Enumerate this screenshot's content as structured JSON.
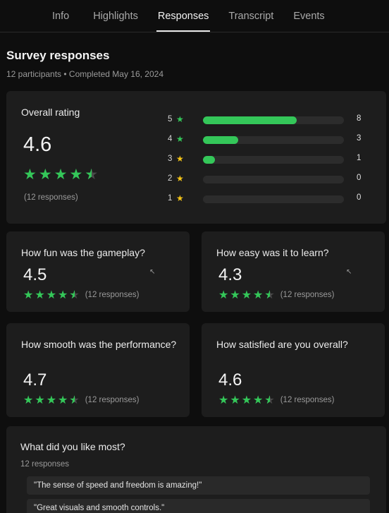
{
  "tabs": [
    {
      "label": "Info",
      "active": false
    },
    {
      "label": "Highlights",
      "active": false
    },
    {
      "label": "Responses",
      "active": true
    },
    {
      "label": "Transcript",
      "active": false
    },
    {
      "label": "Events",
      "active": false
    }
  ],
  "page": {
    "title": "Survey responses",
    "subtitle": "12 participants • Completed May 16, 2024"
  },
  "overall": {
    "label": "Overall rating",
    "value": "4.6",
    "rating": 4.6,
    "responses_label": "(12 responses)",
    "distribution": [
      {
        "stars": "5",
        "count": "8",
        "fraction": 0.667
      },
      {
        "stars": "4",
        "count": "3",
        "fraction": 0.25
      },
      {
        "stars": "3",
        "count": "1",
        "fraction": 0.083
      },
      {
        "stars": "2",
        "count": "0",
        "fraction": 0
      },
      {
        "stars": "1",
        "count": "0",
        "fraction": 0
      }
    ]
  },
  "questions": [
    {
      "label": "How fun was the gameplay?",
      "value": "4.5",
      "rating": 4.5,
      "responses_label": "(12 responses)"
    },
    {
      "label": "How easy was it to learn?",
      "value": "4.3",
      "rating": 4.3,
      "responses_label": "(12 responses)"
    },
    {
      "label": "How smooth was the performance?",
      "value": "4.7",
      "rating": 4.7,
      "responses_label": "(12 responses)"
    },
    {
      "label": "How satisfied are you overall?",
      "value": "4.6",
      "rating": 4.6,
      "responses_label": "(12 responses)"
    }
  ],
  "open_question": {
    "label": "What did you like most?",
    "responses_label": "12 responses",
    "answers": [
      "\"The sense of speed and freedom is amazing!\"",
      "\"Great visuals and smooth controls.\""
    ]
  },
  "colors": {
    "star_green": "#34c759",
    "star_yellow": "#f5c518",
    "background": "#0e0e0e",
    "card": "#1d1d1d"
  },
  "icons": {
    "star": "star-icon",
    "cursor": "mouse-cursor-icon"
  }
}
